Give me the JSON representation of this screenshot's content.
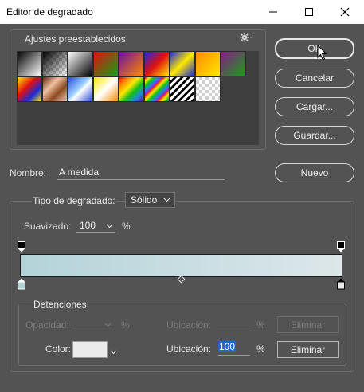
{
  "window": {
    "title": "Editor de degradado"
  },
  "presets": {
    "title": "Ajustes preestablecidos"
  },
  "buttons": {
    "ok": "OK",
    "cancel": "Cancelar",
    "load": "Cargar...",
    "save": "Guardar...",
    "new": "Nuevo"
  },
  "name": {
    "label": "Nombre:",
    "value": "A medida"
  },
  "gradient": {
    "type_label": "Tipo de degradado:",
    "type_value": "Sólido",
    "smoothness_label": "Suavizado:",
    "smoothness_value": "100",
    "smoothness_unit": "%",
    "color_start": "#b3d3d9",
    "color_end": "#dde7ea"
  },
  "stops": {
    "title": "Detenciones",
    "opacity_label": "Opacidad:",
    "opacity_unit": "%",
    "opacity_location_label": "Ubicación:",
    "opacity_location_unit": "%",
    "opacity_delete": "Eliminar",
    "color_label": "Color:",
    "color_value": "#ebebeb",
    "color_location_label": "Ubicación:",
    "color_location_value": "100",
    "color_location_unit": "%",
    "color_delete": "Eliminar"
  }
}
